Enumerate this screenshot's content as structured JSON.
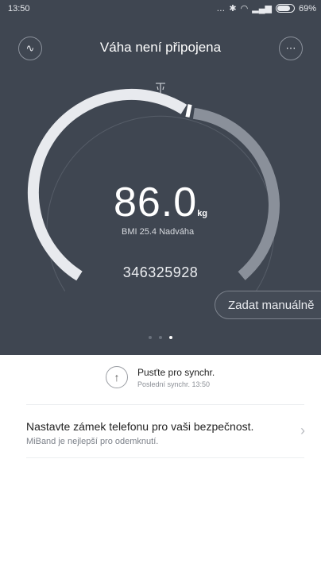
{
  "status_bar": {
    "time": "13:50",
    "battery": "69%"
  },
  "header": {
    "title": "Váha není připojena"
  },
  "measurement": {
    "weight": "86.0",
    "unit": "kg",
    "bmi_text": "BMI 25.4 Nadváha",
    "code": "346325928"
  },
  "manual_button": {
    "label": "Zadat manuálně"
  },
  "pager": {
    "count": 3,
    "active_index": 2
  },
  "sync": {
    "title": "Pusťte pro synchr.",
    "subtitle": "Poslední synchr. 13:50"
  },
  "security_card": {
    "title": "Nastavte zámek telefonu pro vaši bezpečnost.",
    "subtitle": "MiBand je nejlepší pro odemknutí."
  },
  "colors": {
    "header_bg": "#3f4651",
    "arc_light": "#e8eaee",
    "arc_dim": "#8a909a"
  }
}
